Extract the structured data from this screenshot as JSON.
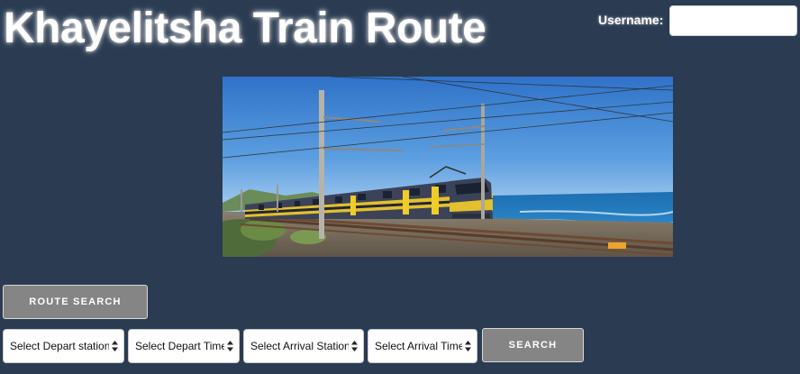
{
  "header": {
    "title": "Khayelitsha Train Route",
    "username_label": "Username:",
    "username_value": ""
  },
  "hero": {
    "image_description": "commuter-train-on-coastal-railway"
  },
  "route_search": {
    "label": "ROUTE SEARCH"
  },
  "search_form": {
    "depart_station": "Select Depart station",
    "depart_time": "Select Depart Time",
    "arrival_station": "Select Arrival Station",
    "arrival_time": "Select Arrival Time",
    "search_label": "SEARCH"
  },
  "colors": {
    "background": "#2a3b52",
    "button": "#858585",
    "title_text": "#ffffff"
  }
}
